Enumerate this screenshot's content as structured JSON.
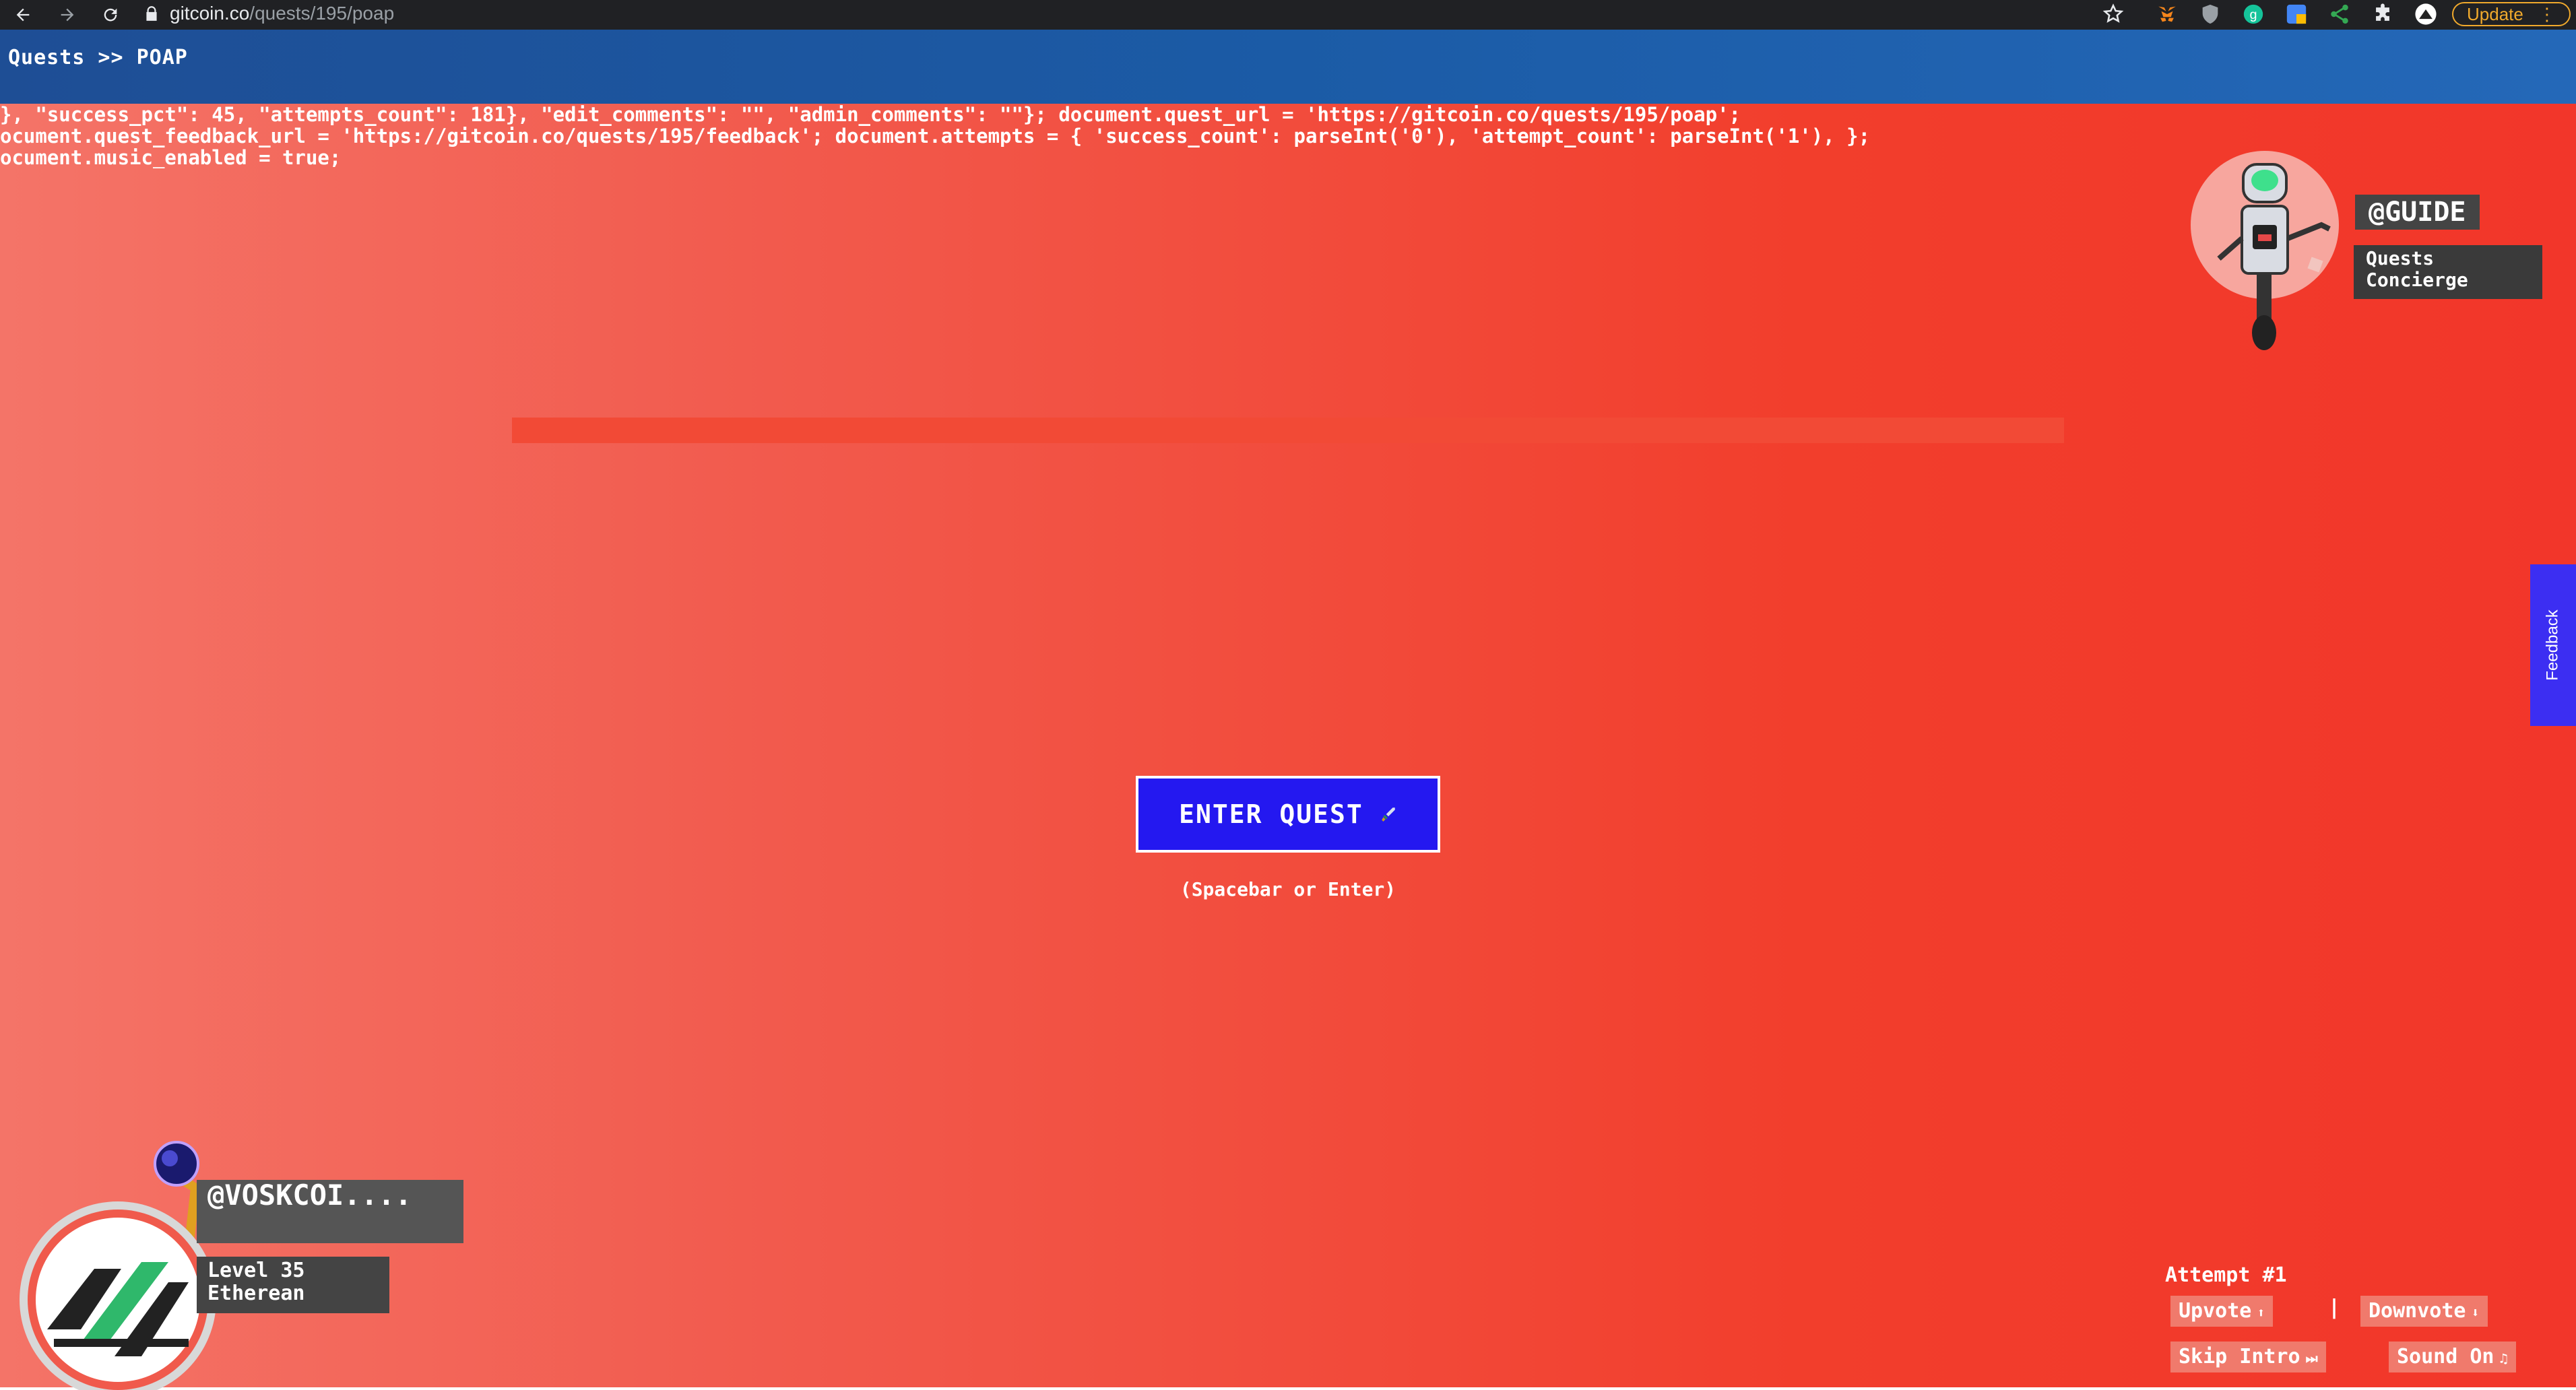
{
  "browser": {
    "url_host": "gitcoin.co",
    "url_path": "/quests/195/poap",
    "update_label": "Update"
  },
  "header": {
    "breadcrumb": "Quests >> POAP"
  },
  "debug_lines": [
    "}, \"success_pct\": 45, \"attempts_count\": 181}, \"edit_comments\": \"\", \"admin_comments\": \"\"}; document.quest_url = 'https://gitcoin.co/quests/195/poap';",
    "ocument.quest_feedback_url = 'https://gitcoin.co/quests/195/feedback'; document.attempts = { 'success_count': parseInt('0'), 'attempt_count': parseInt('1'), };",
    "ocument.music_enabled = true;"
  ],
  "guide": {
    "name": "@GUIDE",
    "title": "Quests Concierge"
  },
  "quest": {
    "enter_label": "ENTER QUEST",
    "hint": "(Spacebar or Enter)"
  },
  "feedback": {
    "label": "Feedback"
  },
  "player": {
    "name": "@VOSKCOI....",
    "level": "Level 35",
    "class": "Etherean"
  },
  "controls": {
    "attempt": "Attempt #1",
    "upvote": "Upvote",
    "separator": "|",
    "downvote": "Downvote",
    "skip_intro": "Skip Intro",
    "sound": "Sound On"
  },
  "colors": {
    "accent_blue": "#2418f0",
    "header_blue": "#1b5ba6",
    "stage_red": "#f23e2c"
  }
}
